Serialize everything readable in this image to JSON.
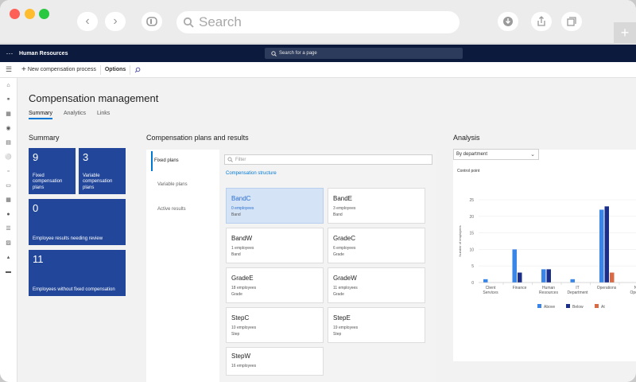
{
  "browser": {
    "search_placeholder": "Search"
  },
  "topbar": {
    "app_name": "Human Resources",
    "search_placeholder": "Search for a page"
  },
  "actionbar": {
    "new_label": "New compensation process",
    "options_label": "Options"
  },
  "page": {
    "title": "Compensation management",
    "tabs": [
      "Summary",
      "Analytics",
      "Links"
    ]
  },
  "summary": {
    "heading": "Summary",
    "tiles": [
      {
        "value": "9",
        "label": "Fixed compensation plans"
      },
      {
        "value": "3",
        "label": "Variable compensation plans"
      },
      {
        "value": "0",
        "label": "Employee results needing review"
      },
      {
        "value": "11",
        "label": "Employees without fixed compensation"
      }
    ]
  },
  "plans": {
    "heading": "Compensation plans and results",
    "tabs": [
      "Fixed plans",
      "Variable plans",
      "Active results"
    ],
    "filter_placeholder": "Filter",
    "section_label": "Compensation structure",
    "cards": [
      {
        "name": "BandC",
        "employees": "0 employees",
        "type": "Band"
      },
      {
        "name": "BandE",
        "employees": "3 employees",
        "type": "Band"
      },
      {
        "name": "BandW",
        "employees": "1 employees",
        "type": "Band"
      },
      {
        "name": "GradeC",
        "employees": "6 employees",
        "type": "Grade"
      },
      {
        "name": "GradeE",
        "employees": "18 employees",
        "type": "Grade"
      },
      {
        "name": "GradeW",
        "employees": "11 employees",
        "type": "Grade"
      },
      {
        "name": "StepC",
        "employees": "10 employees",
        "type": "Step"
      },
      {
        "name": "StepE",
        "employees": "19 employees",
        "type": "Step"
      },
      {
        "name": "StepW",
        "employees": "16 employees",
        "type": ""
      }
    ]
  },
  "analysis": {
    "heading": "Analysis",
    "dropdown_value": "By department",
    "chart_caption": "Control point"
  },
  "colors": {
    "above": "#3a86e8",
    "below": "#1b2f8a",
    "at": "#d96a45",
    "tile": "#22479a"
  },
  "chart_data": {
    "type": "bar",
    "categories": [
      "Client Services",
      "Finance",
      "Human Resources",
      "IT Department",
      "Operations",
      "N... Opera..."
    ],
    "category_lines": [
      [
        "Client",
        "Services"
      ],
      [
        "Finance"
      ],
      [
        "Human",
        "Resources"
      ],
      [
        "IT",
        "Department"
      ],
      [
        "Operations"
      ],
      [
        "N",
        "Opera"
      ]
    ],
    "series": [
      {
        "name": "Above",
        "values": [
          1,
          10,
          4,
          1,
          22,
          0
        ]
      },
      {
        "name": "Below",
        "values": [
          0,
          3,
          4,
          0,
          23,
          0
        ]
      },
      {
        "name": "At",
        "values": [
          0,
          0,
          0,
          0,
          3,
          0
        ]
      }
    ],
    "ylabel": "Number of employees",
    "ylim": [
      0,
      25
    ],
    "yticks": [
      0,
      5,
      10,
      15,
      20,
      25
    ],
    "grid": true,
    "legend": "bottom"
  }
}
